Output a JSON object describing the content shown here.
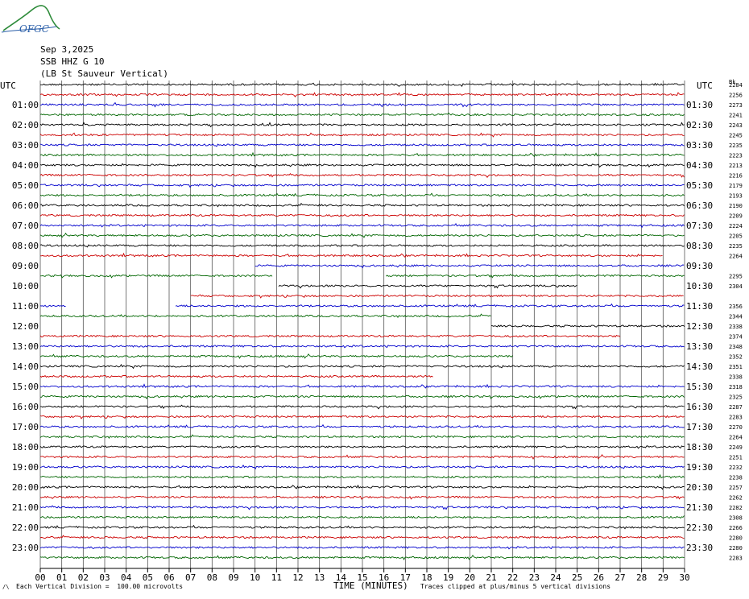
{
  "header": {
    "logo_text": "OFGC",
    "date": "Sep 3,2025",
    "station": "SSB HHZ G 10",
    "location": "(LB St Sauveur Vertical)"
  },
  "footer": {
    "scale_note": "Each Vertical Division =  100.00 microvolts",
    "xlabel": "TIME (MINUTES)",
    "clip_note": "Traces clipped at plus/minus 5 vertical divisions"
  },
  "chart_data": {
    "type": "line",
    "title": "SSB HHZ G 10 (LB St Sauveur Vertical)",
    "xlabel": "TIME (MINUTES)",
    "xlim": [
      0,
      30
    ],
    "x_ticks": [
      "00",
      "01",
      "02",
      "03",
      "04",
      "05",
      "06",
      "07",
      "08",
      "09",
      "10",
      "11",
      "12",
      "13",
      "14",
      "15",
      "16",
      "17",
      "18",
      "19",
      "20",
      "21",
      "22",
      "23",
      "24",
      "25",
      "26",
      "27",
      "28",
      "29",
      "30"
    ],
    "left_axis_title": "UTC",
    "right_axis_title": "UTC",
    "right_value_header": "Bk",
    "left_labels": [
      "01:00",
      "02:00",
      "03:00",
      "04:00",
      "05:00",
      "06:00",
      "07:00",
      "08:00",
      "09:00",
      "10:00",
      "11:00",
      "12:00",
      "13:00",
      "14:00",
      "15:00",
      "16:00",
      "17:00",
      "18:00",
      "19:00",
      "20:00",
      "21:00",
      "22:00",
      "23:00"
    ],
    "right_labels": [
      "01:30",
      "02:30",
      "03:30",
      "04:30",
      "05:30",
      "06:30",
      "07:30",
      "08:30",
      "09:30",
      "10:30",
      "11:30",
      "12:30",
      "13:30",
      "14:30",
      "15:30",
      "16:30",
      "17:30",
      "18:30",
      "19:30",
      "20:30",
      "21:30",
      "22:30",
      "23:30"
    ],
    "trace_colors": [
      "#000000",
      "#cc0000",
      "#0000cc",
      "#006600"
    ],
    "traces": [
      {
        "baseline": "2284",
        "segments": [
          [
            0,
            30
          ]
        ]
      },
      {
        "baseline": "2256",
        "segments": [
          [
            0,
            30
          ]
        ]
      },
      {
        "baseline": "2273",
        "segments": [
          [
            0,
            30
          ]
        ]
      },
      {
        "baseline": "2241",
        "segments": [
          [
            0,
            30
          ]
        ]
      },
      {
        "baseline": "2243",
        "segments": [
          [
            0,
            30
          ]
        ]
      },
      {
        "baseline": "2245",
        "segments": [
          [
            0,
            30
          ]
        ]
      },
      {
        "baseline": "2235",
        "segments": [
          [
            0,
            30
          ]
        ]
      },
      {
        "baseline": "2223",
        "segments": [
          [
            0,
            30
          ]
        ]
      },
      {
        "baseline": "2213",
        "segments": [
          [
            0,
            30
          ]
        ]
      },
      {
        "baseline": "2216",
        "segments": [
          [
            0,
            30
          ]
        ]
      },
      {
        "baseline": "2179",
        "segments": [
          [
            0,
            30
          ]
        ]
      },
      {
        "baseline": "2193",
        "segments": [
          [
            0,
            30
          ]
        ]
      },
      {
        "baseline": "2190",
        "segments": [
          [
            0,
            30
          ]
        ]
      },
      {
        "baseline": "2209",
        "segments": [
          [
            0,
            30
          ]
        ]
      },
      {
        "baseline": "2224",
        "segments": [
          [
            0,
            30
          ]
        ]
      },
      {
        "baseline": "2205",
        "segments": [
          [
            0,
            30
          ]
        ]
      },
      {
        "baseline": "2235",
        "segments": [
          [
            0,
            30
          ]
        ]
      },
      {
        "baseline": "2264",
        "segments": [
          [
            0,
            29
          ]
        ]
      },
      {
        "baseline": "",
        "segments": [
          [
            10,
            30
          ]
        ]
      },
      {
        "baseline": "2295",
        "segments": [
          [
            0,
            10.8
          ],
          [
            16.1,
            30
          ]
        ]
      },
      {
        "baseline": "2304",
        "segments": [
          [
            11.1,
            25
          ]
        ]
      },
      {
        "baseline": "",
        "segments": [
          [
            7,
            30
          ]
        ]
      },
      {
        "baseline": "2356",
        "segments": [
          [
            0,
            1.2
          ],
          [
            6.3,
            30
          ]
        ]
      },
      {
        "baseline": "2344",
        "segments": [
          [
            0,
            21
          ]
        ]
      },
      {
        "baseline": "2338",
        "segments": [
          [
            21,
            30
          ]
        ]
      },
      {
        "baseline": "2374",
        "segments": [
          [
            0,
            27
          ]
        ]
      },
      {
        "baseline": "2348",
        "segments": [
          [
            0,
            30
          ]
        ]
      },
      {
        "baseline": "2352",
        "segments": [
          [
            0,
            22
          ]
        ]
      },
      {
        "baseline": "2351",
        "segments": [
          [
            0,
            30
          ]
        ]
      },
      {
        "baseline": "2338",
        "segments": [
          [
            0,
            18.3
          ]
        ]
      },
      {
        "baseline": "2318",
        "segments": [
          [
            0,
            30
          ]
        ]
      },
      {
        "baseline": "2325",
        "segments": [
          [
            0,
            30
          ]
        ]
      },
      {
        "baseline": "2287",
        "segments": [
          [
            0,
            30
          ]
        ]
      },
      {
        "baseline": "2283",
        "segments": [
          [
            0,
            30
          ]
        ]
      },
      {
        "baseline": "2270",
        "segments": [
          [
            0,
            30
          ]
        ]
      },
      {
        "baseline": "2264",
        "segments": [
          [
            0,
            30
          ]
        ]
      },
      {
        "baseline": "2249",
        "segments": [
          [
            0,
            30
          ]
        ]
      },
      {
        "baseline": "2251",
        "segments": [
          [
            0,
            30
          ]
        ]
      },
      {
        "baseline": "2232",
        "segments": [
          [
            0,
            30
          ]
        ]
      },
      {
        "baseline": "2238",
        "segments": [
          [
            0,
            30
          ]
        ]
      },
      {
        "baseline": "2257",
        "segments": [
          [
            0,
            30
          ]
        ]
      },
      {
        "baseline": "2262",
        "segments": [
          [
            0,
            30
          ]
        ]
      },
      {
        "baseline": "2282",
        "segments": [
          [
            0,
            30
          ]
        ]
      },
      {
        "baseline": "2308",
        "segments": [
          [
            0,
            30
          ]
        ]
      },
      {
        "baseline": "2266",
        "segments": [
          [
            0,
            30
          ]
        ]
      },
      {
        "baseline": "2280",
        "segments": [
          [
            0,
            30
          ]
        ]
      },
      {
        "baseline": "2280",
        "segments": [
          [
            0,
            30
          ]
        ]
      },
      {
        "baseline": "2283",
        "segments": [
          [
            0,
            30
          ]
        ]
      }
    ]
  }
}
